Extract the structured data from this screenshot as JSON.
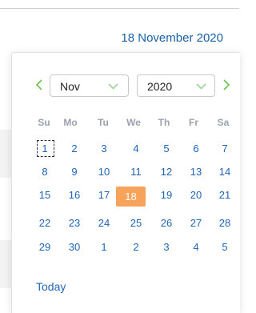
{
  "header": {
    "date_display": "18 November 2020"
  },
  "calendar": {
    "month_select": {
      "value": "Nov"
    },
    "year_select": {
      "value": "2020"
    },
    "weekdays": [
      "Su",
      "Mo",
      "Tu",
      "We",
      "Th",
      "Fr",
      "Sa"
    ],
    "weeks": [
      [
        "1",
        "2",
        "3",
        "4",
        "5",
        "6",
        "7"
      ],
      [
        "8",
        "9",
        "10",
        "11",
        "12",
        "13",
        "14"
      ],
      [
        "15",
        "16",
        "17",
        "18",
        "19",
        "20",
        "21"
      ],
      [
        "22",
        "23",
        "24",
        "25",
        "26",
        "27",
        "28"
      ],
      [
        "29",
        "30",
        "1",
        "2",
        "3",
        "4",
        "5"
      ]
    ],
    "selected_day": "18",
    "focused_day": "1",
    "today_label": "Today",
    "colors": {
      "accent": "#1f64b3",
      "selected": "#f7a35c",
      "arrow": "#6cc04a"
    }
  }
}
